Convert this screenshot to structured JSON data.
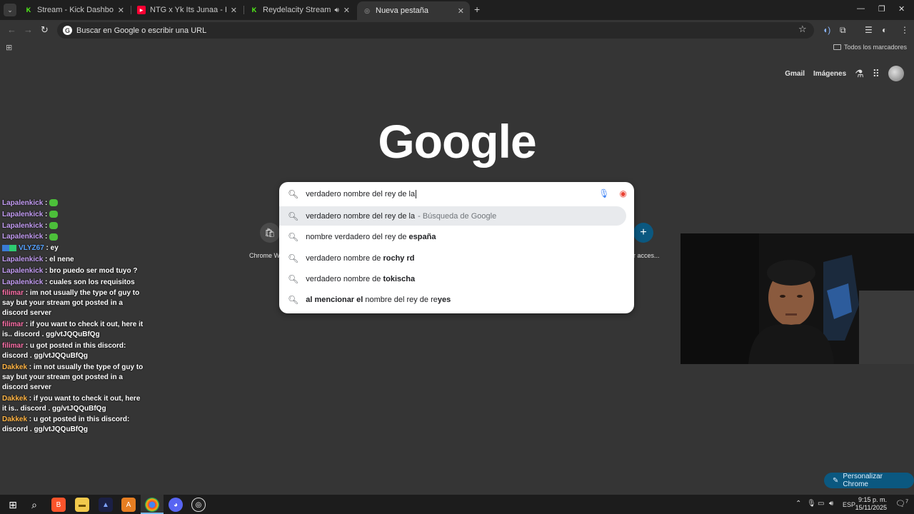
{
  "tabs": [
    {
      "title": "Stream - Kick Dashboard",
      "favicon": "K",
      "color": "#53fc18"
    },
    {
      "title": "NTG x Yk Its Junaa - REPEAT / M",
      "favicon": "▶",
      "color": "#ff0033"
    },
    {
      "title": "Reydelacity Stream - Watch",
      "favicon": "K",
      "color": "#53fc18"
    },
    {
      "title": "Nueva pestaña",
      "favicon": "◎",
      "color": "#aaaaaa"
    }
  ],
  "toolbar": {
    "omnibox_placeholder": "Buscar en Google o escribir una URL"
  },
  "bookmarks": {
    "all_bookmarks": "Todos los marcadores"
  },
  "ntp": {
    "gmail": "Gmail",
    "images": "Imágenes",
    "logo": "Google",
    "customize": "Personalizar Chrome",
    "shortcut_left_label": "Chrome We",
    "shortcut_right_label": "dir acces..."
  },
  "search": {
    "query": "verdadero nombre del rey de la",
    "suggestions": [
      {
        "plain": "verdadero nombre del rey de la",
        "bold": "",
        "suffix": "- Búsqueda de Google"
      },
      {
        "plain": "nombre verdadero del rey de ",
        "bold": "españa",
        "suffix": ""
      },
      {
        "plain": "verdadero nombre de ",
        "bold": "rochy rd",
        "suffix": ""
      },
      {
        "plain": "verdadero nombre de ",
        "bold": "tokischa",
        "suffix": ""
      },
      {
        "bold_lead": "al mencionar el",
        "plain": " nombre del rey de re",
        "bold": "yes",
        "suffix": ""
      }
    ]
  },
  "chat": [
    {
      "user": "Lapalenkick",
      "text": "",
      "emote": true,
      "color": "purple"
    },
    {
      "user": "Lapalenkick",
      "text": "",
      "emote": true,
      "color": "purple"
    },
    {
      "user": "Lapalenkick",
      "text": "",
      "emote": true,
      "color": "purple"
    },
    {
      "user": "Lapalenkick",
      "text": "",
      "emote": true,
      "color": "purple"
    },
    {
      "user": "VLYZ67",
      "text": "ey",
      "emote": false,
      "color": "blue"
    },
    {
      "user": "Lapalenkick",
      "text": "el nene",
      "emote": false,
      "color": "purple"
    },
    {
      "user": "Lapalenkick",
      "text": "bro puedo ser mod tuyo ?",
      "emote": false,
      "color": "purple"
    },
    {
      "user": "Lapalenkick",
      "text": "cuales son los requisitos",
      "emote": false,
      "color": "purple"
    },
    {
      "user": "filimar",
      "text": "im not usually the type of guy to say but your stream got posted in a discord server",
      "emote": false,
      "color": "pink"
    },
    {
      "user": "filimar",
      "text": "if you want to check it out, here it is.. discord . gg/vtJQQuBfQg",
      "emote": false,
      "color": "pink"
    },
    {
      "user": "filimar",
      "text": "u got posted in this discord: discord . gg/vtJQQuBfQg",
      "emote": false,
      "color": "pink"
    },
    {
      "user": "Dakkek",
      "text": "im not usually the type of guy to say but your stream got posted in a discord server",
      "emote": false,
      "color": "orange"
    },
    {
      "user": "Dakkek",
      "text": "if you want to check it out, here it is.. discord . gg/vtJQQuBfQg",
      "emote": false,
      "color": "orange"
    },
    {
      "user": "Dakkek",
      "text": "u got posted in this discord: discord . gg/vtJQQuBfQg",
      "emote": false,
      "color": "orange"
    }
  ],
  "taskbar": {
    "language": "ESP",
    "time": "9:15 p. m.",
    "date": "15/11/2025",
    "notifications": "7"
  }
}
